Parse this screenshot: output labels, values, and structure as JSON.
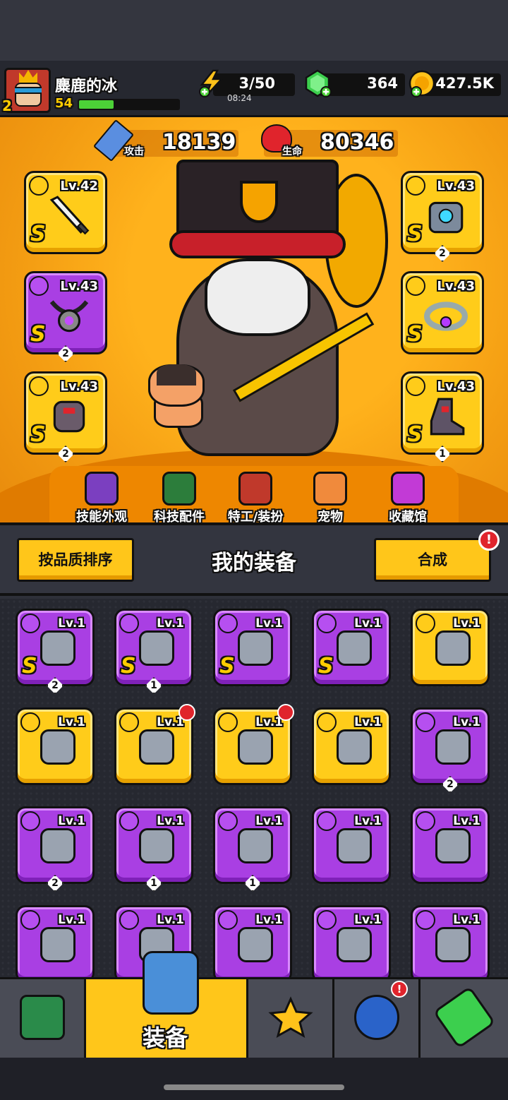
{
  "player": {
    "name": "麋鹿的冰",
    "vip": "2",
    "level": "54",
    "xp_fraction": 0.35
  },
  "resources": {
    "energy": {
      "value": "3/50",
      "timer": "08:24",
      "icon": "lightning-icon"
    },
    "gems": {
      "value": "364",
      "icon": "gem-icon"
    },
    "coins": {
      "value": "427.5K",
      "icon": "coin-icon"
    }
  },
  "stats": {
    "attack": {
      "label": "攻击",
      "value": "18139"
    },
    "health": {
      "label": "生命",
      "value": "80346"
    }
  },
  "equipped": [
    {
      "slot": "weapon",
      "level": "Lv.42",
      "grade": "S",
      "stars": "",
      "color": "gold"
    },
    {
      "slot": "necklace",
      "level": "Lv.43",
      "grade": "S",
      "stars": "2",
      "color": "purple"
    },
    {
      "slot": "gloves",
      "level": "Lv.43",
      "grade": "S",
      "stars": "2",
      "color": "gold"
    },
    {
      "slot": "armor",
      "level": "Lv.43",
      "grade": "S",
      "stars": "2",
      "color": "gold"
    },
    {
      "slot": "belt",
      "level": "Lv.43",
      "grade": "S",
      "stars": "",
      "color": "gold"
    },
    {
      "slot": "boots",
      "level": "Lv.43",
      "grade": "S",
      "stars": "1",
      "color": "gold"
    }
  ],
  "hero_tabs": [
    "技能外观",
    "科技配件",
    "特工/装扮",
    "宠物",
    "收藏馆"
  ],
  "equipment_bar": {
    "title": "我的装备",
    "sort_label": "按品质排序",
    "merge_label": "合成",
    "merge_alert": "!"
  },
  "inventory": [
    {
      "level": "Lv.1",
      "grade": "S",
      "stars": "2",
      "color": "purple",
      "new": false
    },
    {
      "level": "Lv.1",
      "grade": "S",
      "stars": "1",
      "color": "purple",
      "new": false
    },
    {
      "level": "Lv.1",
      "grade": "S",
      "stars": "",
      "color": "purple",
      "new": false
    },
    {
      "level": "Lv.1",
      "grade": "S",
      "stars": "",
      "color": "purple",
      "new": false
    },
    {
      "level": "Lv.1",
      "grade": "",
      "stars": "",
      "color": "gold",
      "new": false
    },
    {
      "level": "Lv.1",
      "grade": "",
      "stars": "",
      "color": "gold",
      "new": false
    },
    {
      "level": "Lv.1",
      "grade": "",
      "stars": "",
      "color": "gold",
      "new": true
    },
    {
      "level": "Lv.1",
      "grade": "",
      "stars": "",
      "color": "gold",
      "new": true
    },
    {
      "level": "Lv.1",
      "grade": "",
      "stars": "",
      "color": "gold",
      "new": false
    },
    {
      "level": "Lv.1",
      "grade": "",
      "stars": "2",
      "color": "purple",
      "new": false
    },
    {
      "level": "Lv.1",
      "grade": "",
      "stars": "2",
      "color": "purple",
      "new": false
    },
    {
      "level": "Lv.1",
      "grade": "",
      "stars": "1",
      "color": "purple",
      "new": false
    },
    {
      "level": "Lv.1",
      "grade": "",
      "stars": "1",
      "color": "purple",
      "new": false
    },
    {
      "level": "Lv.1",
      "grade": "",
      "stars": "",
      "color": "purple",
      "new": false
    },
    {
      "level": "Lv.1",
      "grade": "",
      "stars": "",
      "color": "purple",
      "new": false
    },
    {
      "level": "Lv.1",
      "grade": "",
      "stars": "",
      "color": "purple",
      "new": false
    },
    {
      "level": "Lv.1",
      "grade": "",
      "stars": "",
      "color": "purple",
      "new": false
    },
    {
      "level": "Lv.1",
      "grade": "",
      "stars": "",
      "color": "purple",
      "new": false
    },
    {
      "level": "Lv.1",
      "grade": "",
      "stars": "",
      "color": "purple",
      "new": false
    },
    {
      "level": "Lv.1",
      "grade": "",
      "stars": "",
      "color": "purple",
      "new": false
    }
  ],
  "nav": {
    "active_label": "装备",
    "alert": "!"
  },
  "colors": {
    "gold": "#ffcc1a",
    "purple": "#a93fe3",
    "accent": "#f39c12"
  }
}
